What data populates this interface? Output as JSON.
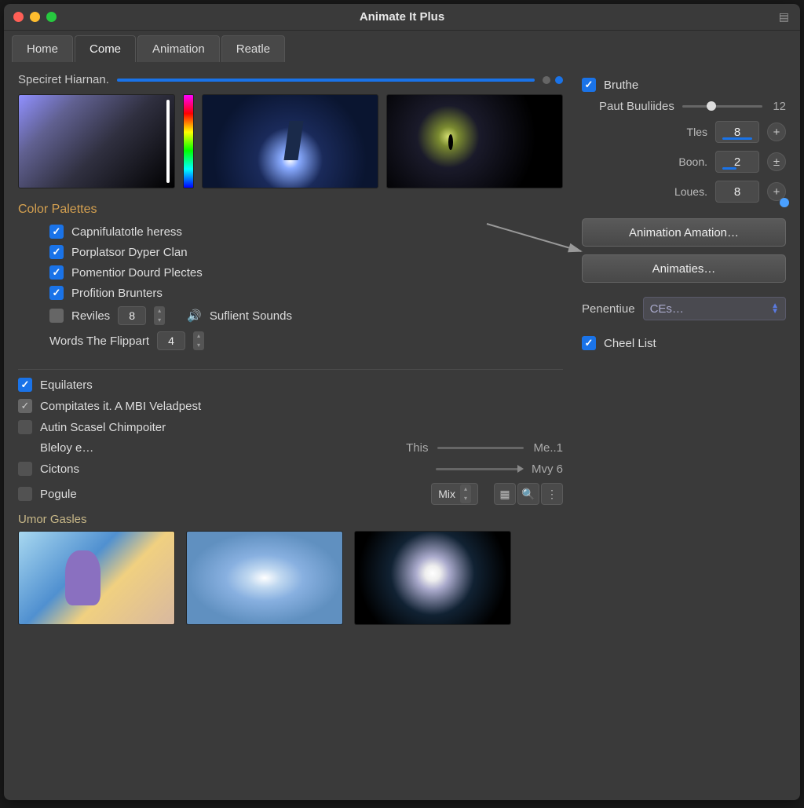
{
  "window": {
    "title": "Animate It Plus"
  },
  "tabs": [
    "Home",
    "Come",
    "Animation",
    "Reatle"
  ],
  "active_tab": 1,
  "top": {
    "label": "Speciret Hiarnan."
  },
  "palettes": {
    "heading": "Color Palettes",
    "items": [
      {
        "label": "Capnifulatotle heress",
        "checked": true
      },
      {
        "label": "Porplatsor  Dyper Clan",
        "checked": true
      },
      {
        "label": "Pomentior  Dourd Plectes",
        "checked": true
      },
      {
        "label": "Profition Brunters",
        "checked": true
      }
    ],
    "reviles": {
      "label": "Reviles",
      "value": "8",
      "checked": false
    },
    "suffix": "Suflient Sounds",
    "words": {
      "label": "Words The Flippart",
      "value": "4"
    }
  },
  "options": {
    "equilaters": {
      "label": "Equilaters",
      "checked": true
    },
    "compitates": {
      "label": "Compitates it. A MBI Veladpest",
      "checked": true
    },
    "autin": {
      "label": "Autin Scasel Chimpoiter",
      "checked": false
    },
    "bleloy": {
      "label": "Bleloy e…",
      "this_label": "This",
      "this_suffix": "Me..1"
    },
    "cictons": {
      "label": "Cictons",
      "suffix": "Mvy 6"
    },
    "pogule": {
      "label": "Pogule",
      "mix": "Mix"
    }
  },
  "gallery": {
    "heading": "Umor Gasles"
  },
  "right": {
    "bruthe": {
      "label": "Bruthe",
      "checked": true
    },
    "paut": {
      "label": "Paut Buuliides",
      "value": "12"
    },
    "tles": {
      "label": "Tles",
      "value": "8"
    },
    "boon": {
      "label": "Boon.",
      "value": "2"
    },
    "loues": {
      "label": "Loues.",
      "value": "8"
    },
    "btn1": "Animation Amation…",
    "btn2": "Animaties…",
    "penentiue": {
      "label": "Penentiue",
      "value": "CEs…"
    },
    "cheel": {
      "label": "Cheel List",
      "checked": true
    }
  }
}
